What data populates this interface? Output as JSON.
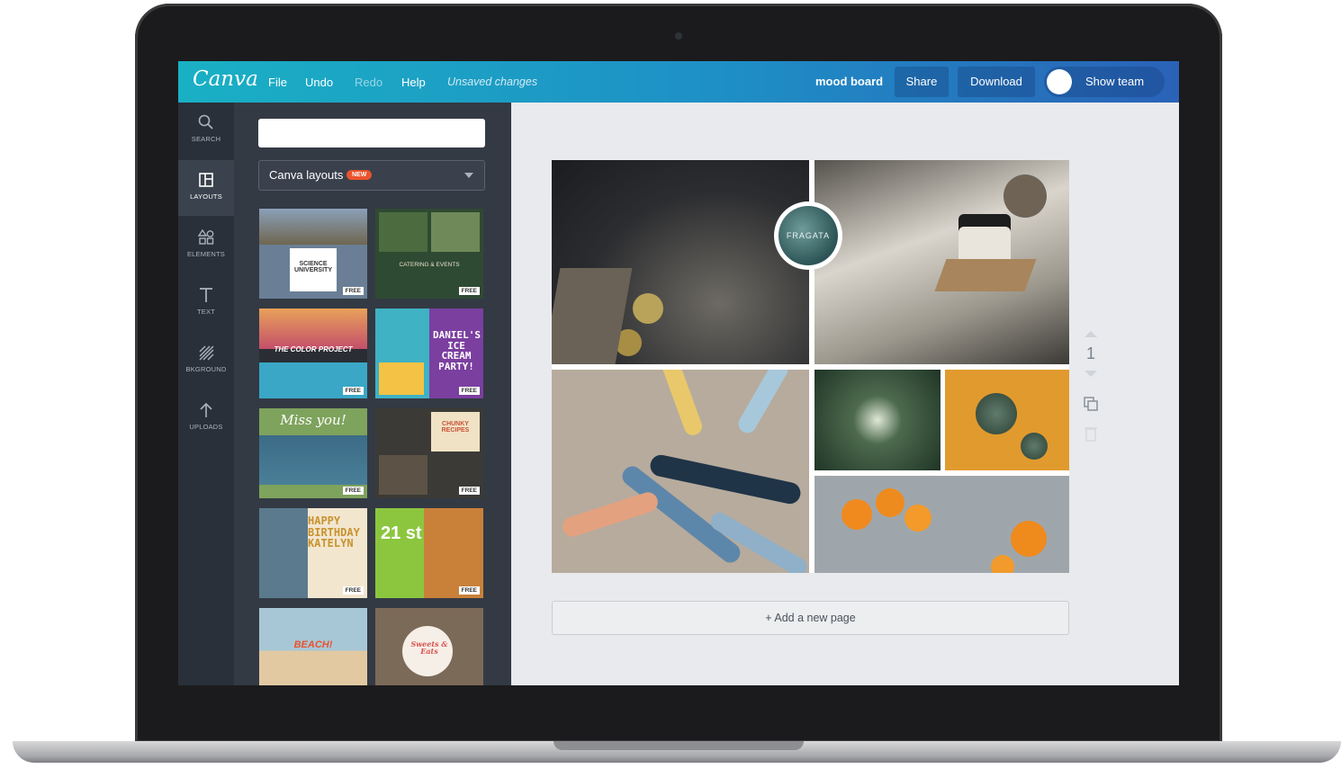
{
  "app": {
    "logo": "Canva"
  },
  "menu": {
    "file": "File",
    "undo": "Undo",
    "redo": "Redo",
    "help": "Help",
    "status": "Unsaved changes"
  },
  "header": {
    "doc_title": "mood board",
    "share": "Share",
    "download": "Download",
    "show_team": "Show team"
  },
  "sidebar": {
    "items": [
      {
        "label": "SEARCH",
        "icon": "search-icon"
      },
      {
        "label": "LAYOUTS",
        "icon": "layouts-icon"
      },
      {
        "label": "ELEMENTS",
        "icon": "elements-icon"
      },
      {
        "label": "TEXT",
        "icon": "text-icon"
      },
      {
        "label": "BKGROUND",
        "icon": "background-icon"
      },
      {
        "label": "UPLOADS",
        "icon": "upload-icon"
      }
    ]
  },
  "panel": {
    "search_value": "",
    "layout_select": "Canva layouts",
    "badge": "NEW",
    "free_label": "FREE",
    "thumbnails": [
      {
        "text": "SCIENCE UNIVERSITY",
        "colors": [
          "#6a7f96",
          "#c9b89b"
        ]
      },
      {
        "text": "CATERING & EVENTS",
        "colors": [
          "#2f4a32",
          "#4c6b3f"
        ]
      },
      {
        "text": "THE COLOR PROJECT",
        "colors": [
          "#e9a15a",
          "#3aa7c7"
        ]
      },
      {
        "text": "DANIEL'S ICE CREAM PARTY!",
        "colors": [
          "#7b3fa0",
          "#f4c244"
        ]
      },
      {
        "text": "Miss you!",
        "colors": [
          "#7ea35d",
          "#3c6b86"
        ]
      },
      {
        "text": "CHUNKY RECIPES",
        "colors": [
          "#3b3a36",
          "#f0e2c4"
        ]
      },
      {
        "text": "HAPPY BIRTHDAY KATELYN",
        "colors": [
          "#5b7a8e",
          "#f2e6cf"
        ]
      },
      {
        "text": "21 st",
        "colors": [
          "#8cc63f",
          "#c9813a"
        ]
      },
      {
        "text": "BEACH!",
        "colors": [
          "#a8c7d6",
          "#e2c9a2"
        ]
      },
      {
        "text": "Sweets & Eats",
        "colors": [
          "#7c6a58",
          "#e8e0d5"
        ]
      }
    ]
  },
  "canvas": {
    "badge_text": "FRAGATA",
    "page_number": "1",
    "add_page": "+ Add a new page"
  },
  "colors": {
    "topbar_start": "#1ab0c4",
    "topbar_end": "#2a62b8",
    "rail": "#293039",
    "panel": "#333a44",
    "badge": "#e9532d"
  }
}
